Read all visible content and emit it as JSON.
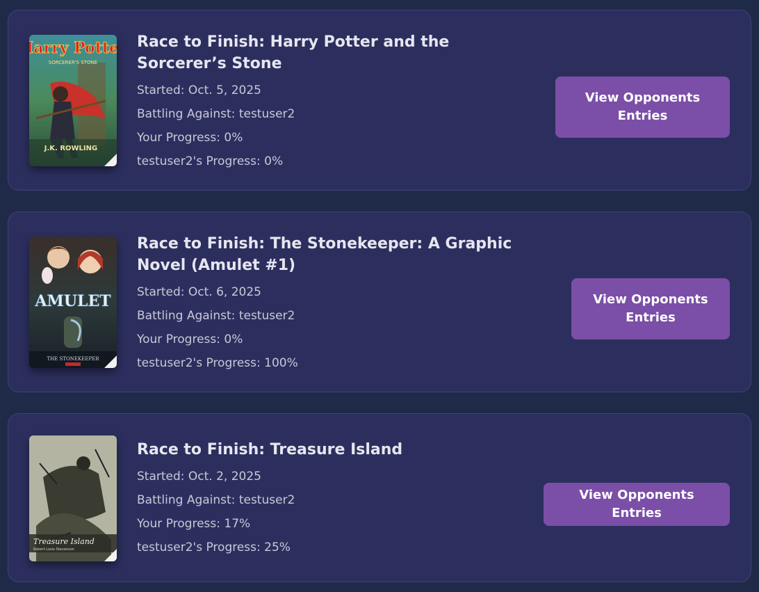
{
  "races": [
    {
      "title": "Race to Finish: Harry Potter and the Sorcerer’s Stone",
      "started": "Started: Oct. 5, 2025",
      "battling": "Battling Against: testuser2",
      "your_progress": "Your Progress: 0%",
      "opponent_progress": "testuser2's Progress: 0%",
      "button_label": "View Opponents Entries",
      "cover": {
        "art_line1": "Harry Potter",
        "art_line2": "SORCERER'S STONE",
        "art_author": "J.K. ROWLING"
      }
    },
    {
      "title": "Race to Finish: The Stonekeeper: A Graphic Novel (Amulet #1)",
      "started": "Started: Oct. 6, 2025",
      "battling": "Battling Against: testuser2",
      "your_progress": "Your Progress: 0%",
      "opponent_progress": "testuser2's Progress: 100%",
      "button_label": "View Opponents Entries",
      "cover": {
        "art_line1": "AMULET",
        "art_line2": "THE STONEKEEPER"
      }
    },
    {
      "title": "Race to Finish: Treasure Island",
      "started": "Started: Oct. 2, 2025",
      "battling": "Battling Against: testuser2",
      "your_progress": "Your Progress: 17%",
      "opponent_progress": "testuser2's Progress: 25%",
      "button_label": "View Opponents Entries",
      "cover": {
        "art_line1": "Treasure Island",
        "art_author": "Robert Louis Stevenson"
      }
    }
  ],
  "colors": {
    "background": "#1e2a48",
    "card": "#2c2f5e",
    "button": "#7b4ea8"
  }
}
